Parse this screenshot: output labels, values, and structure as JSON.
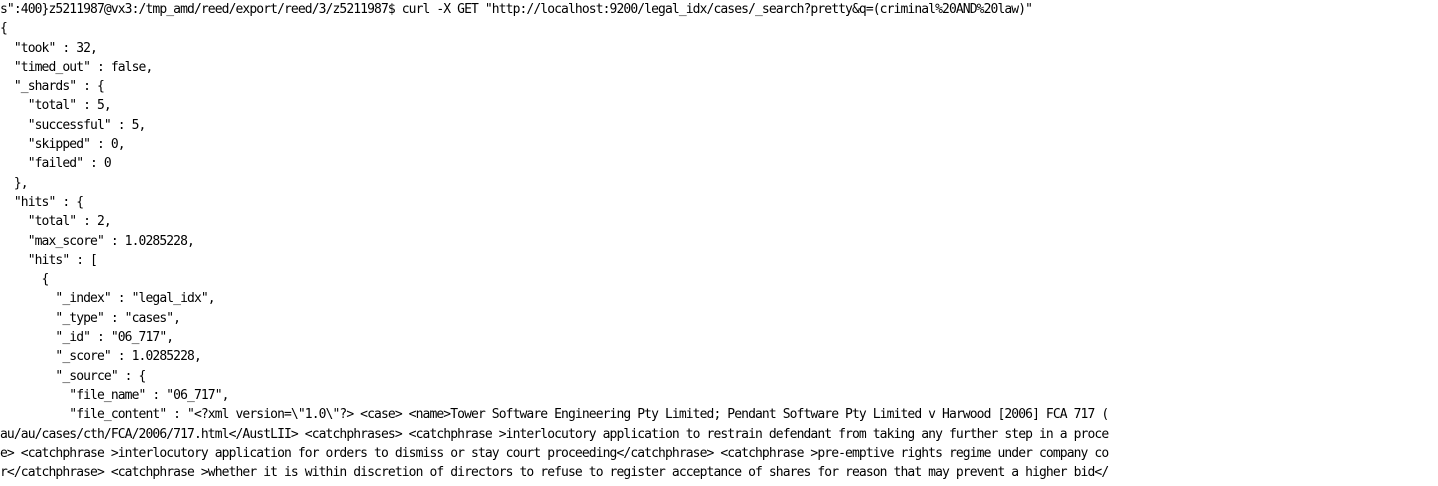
{
  "terminal": {
    "lines": [
      "s\":400}z5211987@vx3:/tmp_amd/reed/export/reed/3/z5211987$ curl -X GET \"http://localhost:9200/legal_idx/cases/_search?pretty&q=(criminal%20AND%20law)\"",
      "{",
      "  \"took\" : 32,",
      "  \"timed_out\" : false,",
      "  \"_shards\" : {",
      "    \"total\" : 5,",
      "    \"successful\" : 5,",
      "    \"skipped\" : 0,",
      "    \"failed\" : 0",
      "  },",
      "  \"hits\" : {",
      "    \"total\" : 2,",
      "    \"max_score\" : 1.0285228,",
      "    \"hits\" : [",
      "      {",
      "        \"_index\" : \"legal_idx\",",
      "        \"_type\" : \"cases\",",
      "        \"_id\" : \"06_717\",",
      "        \"_score\" : 1.0285228,",
      "        \"_source\" : {",
      "          \"file_name\" : \"06_717\",",
      "          \"file_content\" : \"<?xml version=\\\"1.0\\\"?> <case> <name>Tower Software Engineering Pty Limited; Pendant Software Pty Limited v Harwood [2006] FCA 717 (",
      "au/au/cases/cth/FCA/2006/717.html</AustLII> <catchphrases> <catchphrase >interlocutory application to restrain defendant from taking any further step in a proce",
      "e> <catchphrase >interlocutory application for orders to dismiss or stay court proceeding</catchphrase> <catchphrase >pre-emptive rights regime under company co",
      "r</catchphrase> <catchphrase >whether it is within discretion of directors to refuse to register acceptance of shares for reason that may prevent a higher bid</"
    ]
  }
}
